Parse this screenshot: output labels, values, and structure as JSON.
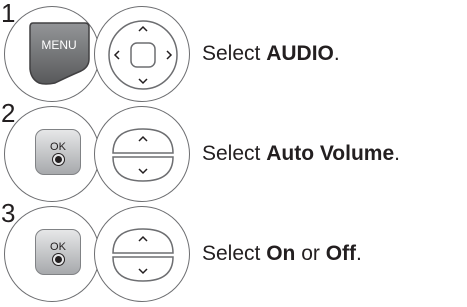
{
  "steps": [
    {
      "number": "1",
      "key": "MENU",
      "prefix": "Select ",
      "bold": "AUDIO",
      "suffix": "."
    },
    {
      "number": "2",
      "key": "OK",
      "prefix": "Select ",
      "bold": "Auto Volume",
      "suffix": "."
    },
    {
      "number": "3",
      "key": "OK",
      "prefix": "Select ",
      "bold": "On",
      "middle": " or ",
      "bold2": "Off",
      "suffix": "."
    }
  ],
  "icons": [
    "menu-button-icon",
    "navigation-pad-icon",
    "ok-button-icon",
    "up-down-buttons-icon"
  ]
}
